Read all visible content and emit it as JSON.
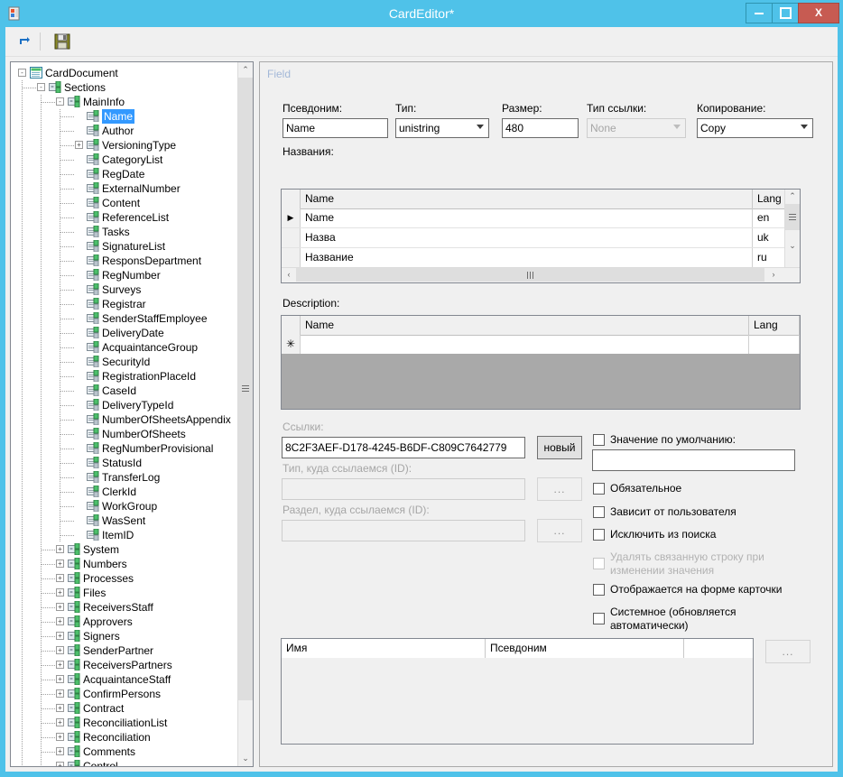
{
  "window": {
    "title": "CardEditor*",
    "app_icon": "app-icon",
    "buttons": {
      "minimize": "–",
      "maximize": "□",
      "close": "X"
    }
  },
  "toolbar": {
    "items": [
      {
        "name": "refresh-icon",
        "glyph": "⇄"
      },
      {
        "name": "save-icon",
        "glyph": "💾"
      }
    ]
  },
  "tree": {
    "nodes": [
      {
        "label": "CardDocument",
        "depth": 0,
        "expander": "-",
        "icon": "document-icon",
        "selected": false
      },
      {
        "label": "Sections",
        "depth": 1,
        "expander": "-",
        "icon": "section-icon",
        "selected": false
      },
      {
        "label": "MainInfo",
        "depth": 2,
        "expander": "-",
        "icon": "section-icon",
        "selected": false
      },
      {
        "label": "Name",
        "depth": 3,
        "expander": "",
        "icon": "field-icon",
        "selected": true
      },
      {
        "label": "Author",
        "depth": 3,
        "expander": "",
        "icon": "field-icon",
        "selected": false
      },
      {
        "label": "VersioningType",
        "depth": 3,
        "expander": "+",
        "icon": "field-icon",
        "selected": false
      },
      {
        "label": "CategoryList",
        "depth": 3,
        "expander": "",
        "icon": "field-icon",
        "selected": false
      },
      {
        "label": "RegDate",
        "depth": 3,
        "expander": "",
        "icon": "field-icon",
        "selected": false
      },
      {
        "label": "ExternalNumber",
        "depth": 3,
        "expander": "",
        "icon": "field-icon",
        "selected": false
      },
      {
        "label": "Content",
        "depth": 3,
        "expander": "",
        "icon": "field-icon",
        "selected": false
      },
      {
        "label": "ReferenceList",
        "depth": 3,
        "expander": "",
        "icon": "field-icon",
        "selected": false
      },
      {
        "label": "Tasks",
        "depth": 3,
        "expander": "",
        "icon": "field-icon",
        "selected": false
      },
      {
        "label": "SignatureList",
        "depth": 3,
        "expander": "",
        "icon": "field-icon",
        "selected": false
      },
      {
        "label": "ResponsDepartment",
        "depth": 3,
        "expander": "",
        "icon": "field-icon",
        "selected": false
      },
      {
        "label": "RegNumber",
        "depth": 3,
        "expander": "",
        "icon": "field-icon",
        "selected": false
      },
      {
        "label": "Surveys",
        "depth": 3,
        "expander": "",
        "icon": "field-icon",
        "selected": false
      },
      {
        "label": "Registrar",
        "depth": 3,
        "expander": "",
        "icon": "field-icon",
        "selected": false
      },
      {
        "label": "SenderStaffEmployee",
        "depth": 3,
        "expander": "",
        "icon": "field-icon",
        "selected": false
      },
      {
        "label": "DeliveryDate",
        "depth": 3,
        "expander": "",
        "icon": "field-icon",
        "selected": false
      },
      {
        "label": "AcquaintanceGroup",
        "depth": 3,
        "expander": "",
        "icon": "field-icon",
        "selected": false
      },
      {
        "label": "SecurityId",
        "depth": 3,
        "expander": "",
        "icon": "field-icon",
        "selected": false
      },
      {
        "label": "RegistrationPlaceId",
        "depth": 3,
        "expander": "",
        "icon": "field-icon",
        "selected": false
      },
      {
        "label": "CaseId",
        "depth": 3,
        "expander": "",
        "icon": "field-icon",
        "selected": false
      },
      {
        "label": "DeliveryTypeId",
        "depth": 3,
        "expander": "",
        "icon": "field-icon",
        "selected": false
      },
      {
        "label": "NumberOfSheetsAppendix",
        "depth": 3,
        "expander": "",
        "icon": "field-icon",
        "selected": false
      },
      {
        "label": "NumberOfSheets",
        "depth": 3,
        "expander": "",
        "icon": "field-icon",
        "selected": false
      },
      {
        "label": "RegNumberProvisional",
        "depth": 3,
        "expander": "",
        "icon": "field-icon",
        "selected": false
      },
      {
        "label": "StatusId",
        "depth": 3,
        "expander": "",
        "icon": "field-icon",
        "selected": false
      },
      {
        "label": "TransferLog",
        "depth": 3,
        "expander": "",
        "icon": "field-icon",
        "selected": false
      },
      {
        "label": "ClerkId",
        "depth": 3,
        "expander": "",
        "icon": "field-icon",
        "selected": false
      },
      {
        "label": "WorkGroup",
        "depth": 3,
        "expander": "",
        "icon": "field-icon",
        "selected": false
      },
      {
        "label": "WasSent",
        "depth": 3,
        "expander": "",
        "icon": "field-icon",
        "selected": false
      },
      {
        "label": "ItemID",
        "depth": 3,
        "expander": "",
        "icon": "field-icon",
        "selected": false
      },
      {
        "label": "System",
        "depth": 2,
        "expander": "+",
        "icon": "section-icon",
        "selected": false
      },
      {
        "label": "Numbers",
        "depth": 2,
        "expander": "+",
        "icon": "section-icon",
        "selected": false
      },
      {
        "label": "Processes",
        "depth": 2,
        "expander": "+",
        "icon": "section-icon",
        "selected": false
      },
      {
        "label": "Files",
        "depth": 2,
        "expander": "+",
        "icon": "section-icon",
        "selected": false
      },
      {
        "label": "ReceiversStaff",
        "depth": 2,
        "expander": "+",
        "icon": "section-icon",
        "selected": false
      },
      {
        "label": "Approvers",
        "depth": 2,
        "expander": "+",
        "icon": "section-icon",
        "selected": false
      },
      {
        "label": "Signers",
        "depth": 2,
        "expander": "+",
        "icon": "section-icon",
        "selected": false
      },
      {
        "label": "SenderPartner",
        "depth": 2,
        "expander": "+",
        "icon": "section-icon",
        "selected": false
      },
      {
        "label": "ReceiversPartners",
        "depth": 2,
        "expander": "+",
        "icon": "section-icon",
        "selected": false
      },
      {
        "label": "AcquaintanceStaff",
        "depth": 2,
        "expander": "+",
        "icon": "section-icon",
        "selected": false
      },
      {
        "label": "ConfirmPersons",
        "depth": 2,
        "expander": "+",
        "icon": "section-icon",
        "selected": false
      },
      {
        "label": "Contract",
        "depth": 2,
        "expander": "+",
        "icon": "section-icon",
        "selected": false
      },
      {
        "label": "ReconciliationList",
        "depth": 2,
        "expander": "+",
        "icon": "section-icon",
        "selected": false
      },
      {
        "label": "Reconciliation",
        "depth": 2,
        "expander": "+",
        "icon": "section-icon",
        "selected": false
      },
      {
        "label": "Comments",
        "depth": 2,
        "expander": "+",
        "icon": "section-icon",
        "selected": false
      },
      {
        "label": "Control",
        "depth": 2,
        "expander": "+",
        "icon": "section-icon",
        "selected": false
      }
    ]
  },
  "field_panel": {
    "group_title": "Field",
    "alias": {
      "label": "Псевдоним:",
      "value": "Name"
    },
    "type": {
      "label": "Тип:",
      "value": "unistring"
    },
    "size": {
      "label": "Размер:",
      "value": "480"
    },
    "ref_type": {
      "label": "Тип ссылки:",
      "value": "None",
      "disabled": true
    },
    "copying": {
      "label": "Копирование:",
      "value": "Copy"
    },
    "names_grid": {
      "label": "Названия:",
      "columns": [
        "Name",
        "Lang"
      ],
      "rows": [
        {
          "current": true,
          "name": "Name",
          "lang": "en"
        },
        {
          "current": false,
          "name": "Назва",
          "lang": "uk"
        },
        {
          "current": false,
          "name": "Название",
          "lang": "ru"
        }
      ]
    },
    "description_grid": {
      "label": "Description:",
      "columns": [
        "Name",
        "Lang"
      ],
      "rows": [
        {
          "new_row": true,
          "marker": "✳",
          "name": "",
          "lang": ""
        }
      ]
    },
    "links": {
      "label": "Ссылки:",
      "value": "8C2F3AEF-D178-4245-B6DF-C809C7642779",
      "new_button": "новый",
      "ref_type_id": {
        "label": "Тип, куда ссылаемся (ID):",
        "value": "",
        "button": "...",
        "disabled": true
      },
      "ref_section_id": {
        "label": "Раздел, куда ссылаемся (ID):",
        "value": "",
        "button": "...",
        "disabled": true
      }
    },
    "options": {
      "default_value": {
        "label": "Значение по умолчанию:",
        "checked": false,
        "value": ""
      },
      "checkboxes": [
        {
          "label": "Обязательное",
          "checked": false,
          "disabled": false
        },
        {
          "label": "Зависит от пользователя",
          "checked": false,
          "disabled": false
        },
        {
          "label": "Исключить из поиска",
          "checked": false,
          "disabled": false
        },
        {
          "label": "Удалять связанную строку при изменении значения",
          "checked": false,
          "disabled": true
        },
        {
          "label": "Отображается на форме карточки",
          "checked": false,
          "disabled": false
        },
        {
          "label": "Системное (обновляется автоматически)",
          "checked": false,
          "disabled": false
        }
      ]
    },
    "bottom_grid": {
      "columns": [
        "Имя",
        "Псевдоним",
        ""
      ],
      "rows": [],
      "side_button": "..."
    }
  },
  "colors": {
    "accent": "#4fc2e9",
    "close": "#c75b52",
    "selection": "#3399ff",
    "group_title": "#a3b8d8",
    "panel_bg": "#f0f0f0",
    "dead_area": "#a9a9a9"
  }
}
